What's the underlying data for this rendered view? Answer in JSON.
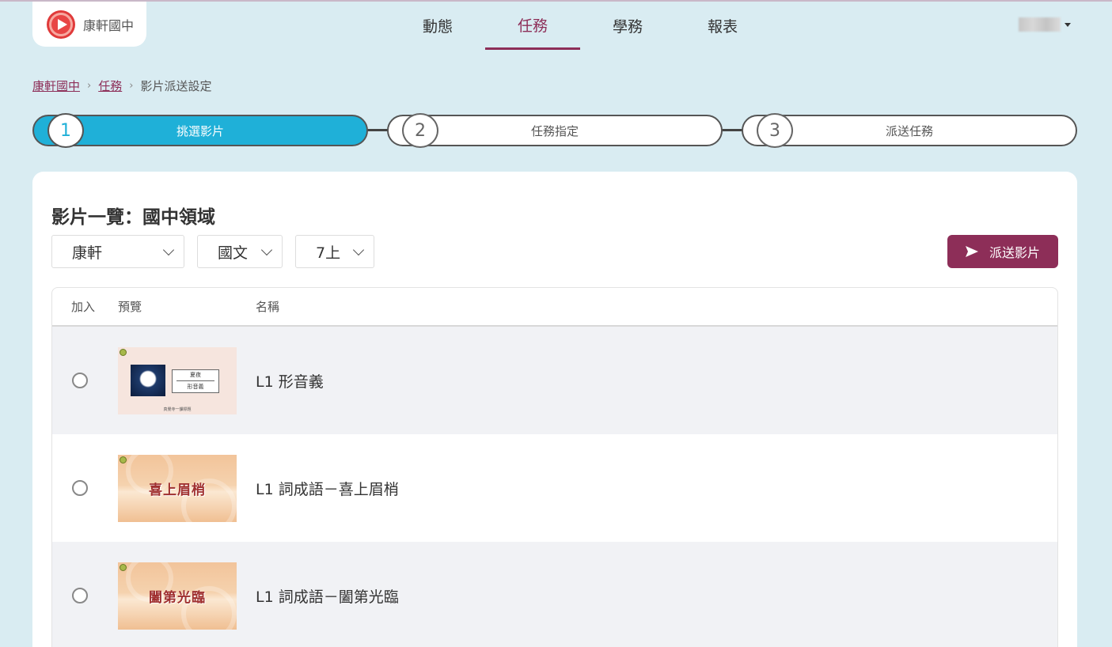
{
  "header": {
    "logo_text": "康軒國中",
    "nav": [
      {
        "label": "動態",
        "active": false
      },
      {
        "label": "任務",
        "active": true
      },
      {
        "label": "學務",
        "active": false
      },
      {
        "label": "報表",
        "active": false
      }
    ]
  },
  "breadcrumb": {
    "items": [
      "康軒國中",
      "任務",
      "影片派送設定"
    ],
    "separator": "›"
  },
  "steps": [
    {
      "number": "1",
      "label": "挑選影片",
      "active": true
    },
    {
      "number": "2",
      "label": "任務指定",
      "active": false
    },
    {
      "number": "3",
      "label": "派送任務",
      "active": false
    }
  ],
  "card": {
    "title": "影片一覽：國中領域",
    "filters": {
      "publisher": "康軒",
      "subject": "國文",
      "grade": "7上"
    },
    "send_button": "派送影片",
    "table": {
      "columns": [
        "加入",
        "預覽",
        "名稱"
      ],
      "rows": [
        {
          "name": "L1 形音義",
          "thumb_line1": "夏夜",
          "thumb_line2": "形音義",
          "thumb_footer": "真覺寺一課標題"
        },
        {
          "name": "L1 詞成語－喜上眉梢",
          "thumb_text": "喜上眉梢"
        },
        {
          "name": "L1 詞成語－闔第光臨",
          "thumb_text": "闔第光臨"
        }
      ]
    }
  },
  "colors": {
    "accent": "#8d2e58",
    "step_active": "#1fb0d8",
    "background": "#d9ecf2"
  }
}
